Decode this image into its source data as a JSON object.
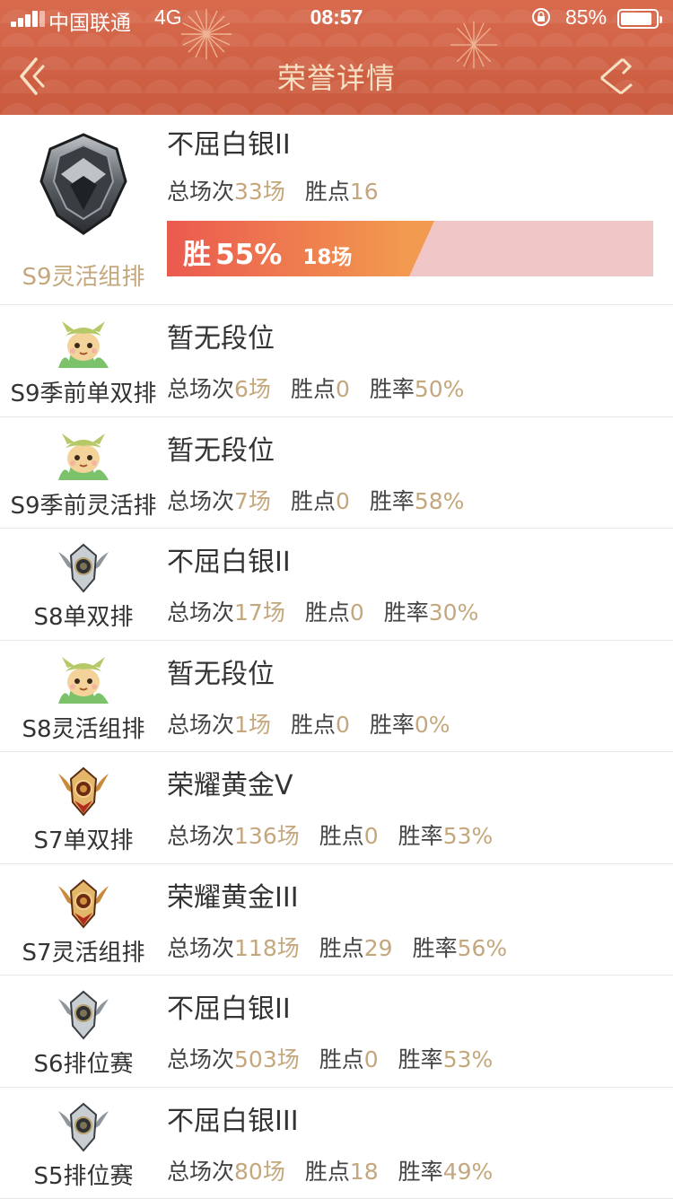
{
  "status_bar": {
    "carrier": "中国联通",
    "network": "4G",
    "time": "08:57",
    "battery": "85%",
    "battery_level": 0.85
  },
  "header": {
    "title": "荣誉详情",
    "back_icon": "back-arrow-icon",
    "share_icon": "share-icon"
  },
  "labels": {
    "total": "总场次",
    "points": "胜点",
    "winrate": "胜率",
    "games_unit": "场",
    "win": "胜"
  },
  "featured": {
    "mode": "S9灵活组排",
    "rank": "不屈白银II",
    "icon": "silver-rank-emblem",
    "total": "33",
    "points": "16",
    "win_pct_text": "55%",
    "win_pct": 0.55,
    "wins_text": "18场"
  },
  "records": [
    {
      "mode": "S9季前单双排",
      "rank": "暂无段位",
      "icon": "unranked-teemo",
      "total": "6",
      "points": "0",
      "winrate": "50%"
    },
    {
      "mode": "S9季前灵活排",
      "rank": "暂无段位",
      "icon": "unranked-teemo",
      "total": "7",
      "points": "0",
      "winrate": "58%"
    },
    {
      "mode": "S8单双排",
      "rank": "不屈白银II",
      "icon": "silver-rank",
      "total": "17",
      "points": "0",
      "winrate": "30%"
    },
    {
      "mode": "S8灵活组排",
      "rank": "暂无段位",
      "icon": "unranked-teemo",
      "total": "1",
      "points": "0",
      "winrate": "0%"
    },
    {
      "mode": "S7单双排",
      "rank": "荣耀黄金V",
      "icon": "gold-rank",
      "total": "136",
      "points": "0",
      "winrate": "53%"
    },
    {
      "mode": "S7灵活组排",
      "rank": "荣耀黄金III",
      "icon": "gold-rank",
      "total": "118",
      "points": "29",
      "winrate": "56%"
    },
    {
      "mode": "S6排位赛",
      "rank": "不屈白银II",
      "icon": "silver-rank",
      "total": "503",
      "points": "0",
      "winrate": "53%"
    },
    {
      "mode": "S5排位赛",
      "rank": "不屈白银III",
      "icon": "silver-rank",
      "total": "80",
      "points": "18",
      "winrate": "49%"
    }
  ],
  "colors": {
    "header": "#d0603f",
    "title": "#f7e1c4",
    "value": "#c4a77c",
    "bar_start": "#eb5a4f",
    "bar_end": "#f29a4f",
    "bar_bg": "#f1c6c6"
  }
}
